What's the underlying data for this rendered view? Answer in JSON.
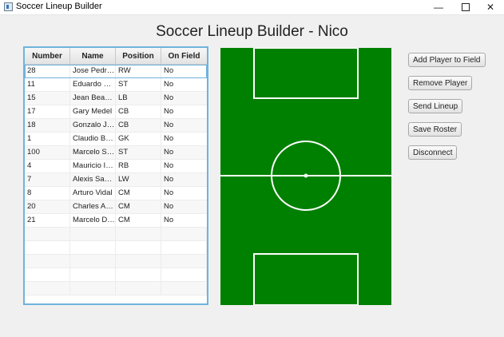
{
  "window": {
    "title": "Soccer Lineup Builder"
  },
  "page": {
    "title": "Soccer Lineup Builder - Nico"
  },
  "table": {
    "columns": [
      "Number",
      "Name",
      "Position",
      "On Field"
    ],
    "rows": [
      [
        "28",
        "Jose Pedro ...",
        "RW",
        "No"
      ],
      [
        "11",
        "Eduardo Va...",
        "ST",
        "No"
      ],
      [
        "15",
        "Jean Beaus...",
        "LB",
        "No"
      ],
      [
        "17",
        "Gary Medel",
        "CB",
        "No"
      ],
      [
        "18",
        "Gonzalo Jara",
        "CB",
        "No"
      ],
      [
        "1",
        "Claudio Bra...",
        "GK",
        "No"
      ],
      [
        "100",
        "Marcelo Salas",
        "ST",
        "No"
      ],
      [
        "4",
        "Mauricio Isla",
        "RB",
        "No"
      ],
      [
        "7",
        "Alexis Sanc...",
        "LW",
        "No"
      ],
      [
        "8",
        "Arturo Vidal",
        "CM",
        "No"
      ],
      [
        "20",
        "Charles Ara...",
        "CM",
        "No"
      ],
      [
        "21",
        "Marcelo Diaz",
        "CM",
        "No"
      ]
    ]
  },
  "buttons": {
    "add_player": "Add Player to Field",
    "remove_player": "Remove Player",
    "send_lineup": "Send Lineup",
    "save_roster": "Save Roster",
    "disconnect": "Disconnect"
  },
  "colors": {
    "pitch": "#008000",
    "lines": "#ffffff",
    "selection": "#6fb3de"
  }
}
